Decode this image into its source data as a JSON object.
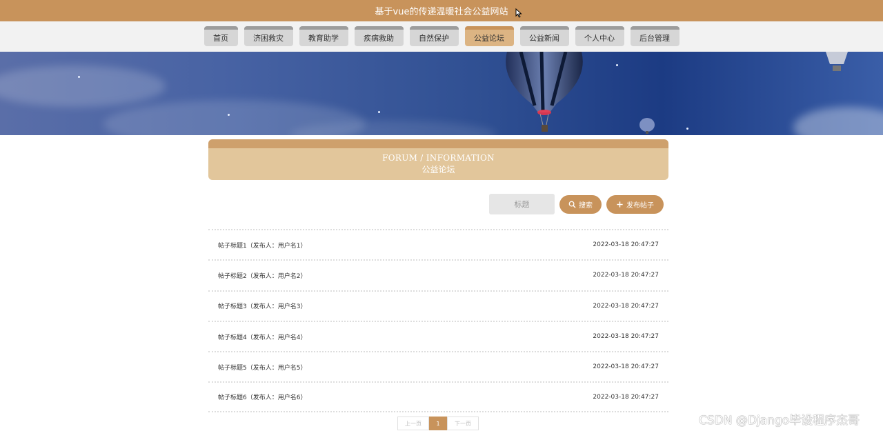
{
  "site": {
    "title": "基于vue的传递温暖社会公益网站"
  },
  "nav": {
    "items": [
      {
        "label": "首页"
      },
      {
        "label": "济困救灾"
      },
      {
        "label": "教育助学"
      },
      {
        "label": "疾病救助"
      },
      {
        "label": "自然保护"
      },
      {
        "label": "公益论坛"
      },
      {
        "label": "公益新闻"
      },
      {
        "label": "个人中心"
      },
      {
        "label": "后台管理"
      }
    ],
    "active": "公益论坛"
  },
  "section": {
    "en": "FORUM / INFORMATION",
    "cn": "公益论坛"
  },
  "search": {
    "placeholder": "标题",
    "button": "搜索",
    "add_button": "发布帖子"
  },
  "posts": [
    {
      "title": "帖子标题1（发布人：用户名1）",
      "time": "2022-03-18 20:47:27"
    },
    {
      "title": "帖子标题2（发布人：用户名2）",
      "time": "2022-03-18 20:47:27"
    },
    {
      "title": "帖子标题3（发布人：用户名3）",
      "time": "2022-03-18 20:47:27"
    },
    {
      "title": "帖子标题4（发布人：用户名4）",
      "time": "2022-03-18 20:47:27"
    },
    {
      "title": "帖子标题5（发布人：用户名5）",
      "time": "2022-03-18 20:47:27"
    },
    {
      "title": "帖子标题6（发布人：用户名6）",
      "time": "2022-03-18 20:47:27"
    }
  ],
  "pagination": {
    "prev": "上一页",
    "current": "1",
    "next": "下一页"
  },
  "watermark": "CSDN @Django毕设程序杰哥",
  "colors": {
    "accent": "#c8935b",
    "header_band": "#e2c69b",
    "nav_bg": "#f2f2f2"
  }
}
